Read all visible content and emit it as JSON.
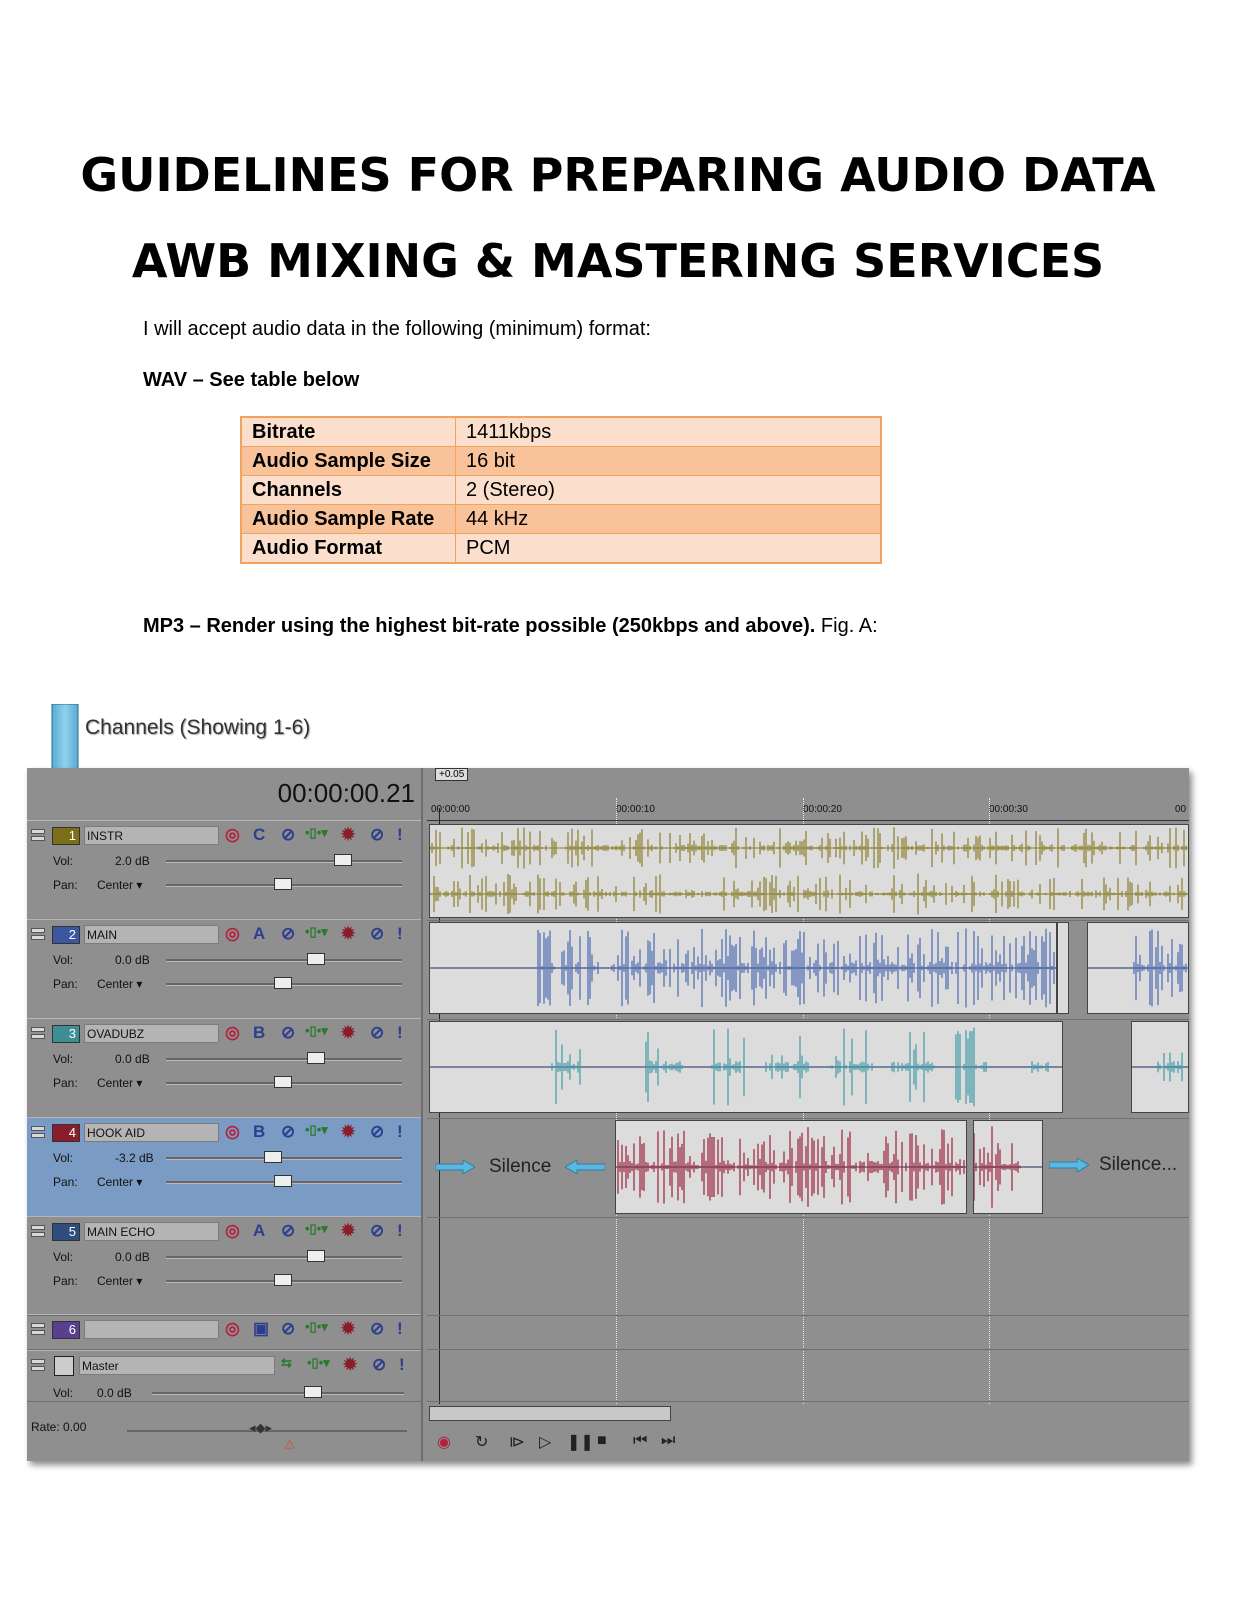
{
  "doc": {
    "title": "GUIDELINES FOR PREPARING AUDIO DATA",
    "subtitle": "AWB MIXING & MASTERING SERVICES",
    "intro": "I will accept audio data in the following (minimum) format:",
    "wav_heading": "WAV – See table below",
    "spec_table": [
      {
        "key": "Bitrate",
        "value": "1411kbps"
      },
      {
        "key": "Audio Sample Size",
        "value": "16 bit"
      },
      {
        "key": "Channels",
        "value": "2 (Stereo)"
      },
      {
        "key": "Audio Sample Rate",
        "value": "44 kHz"
      },
      {
        "key": "Audio Format",
        "value": "PCM"
      }
    ],
    "mp3_bold": "MP3 – Render using the highest bit-rate possible (250kbps and above).",
    "mp3_fig": " Fig. A:"
  },
  "figure": {
    "channels_label": "Channels (Showing 1-6)",
    "time_display": "00:00:00.21",
    "zoom_badge": "+0.05",
    "ruler": [
      "00:00:00",
      "00:00:10",
      "00:00:20",
      "00:00:30",
      "00"
    ],
    "tracks": [
      {
        "num": "1",
        "name": "INSTR",
        "letter": "C",
        "vol": "2.0 dB",
        "pan": "Center",
        "color": "#7c6f1a"
      },
      {
        "num": "2",
        "name": "MAIN",
        "letter": "A",
        "vol": "0.0 dB",
        "pan": "Center",
        "color": "#3a57a0"
      },
      {
        "num": "3",
        "name": "OVADUBZ",
        "letter": "B",
        "vol": "0.0 dB",
        "pan": "Center",
        "color": "#3d8f94"
      },
      {
        "num": "4",
        "name": "HOOK AID",
        "letter": "B",
        "vol": "-3.2 dB",
        "pan": "Center",
        "color": "#8a1d2c"
      },
      {
        "num": "5",
        "name": "MAIN ECHO",
        "letter": "A",
        "vol": "0.0 dB",
        "pan": "Center",
        "color": "#2e4d7a"
      }
    ],
    "track6": {
      "num": "6",
      "color": "#5b3f8f"
    },
    "master": {
      "name": "Master",
      "vol_label": "Vol:",
      "vol": "0.0 dB"
    },
    "vol_label": "Vol:",
    "pan_label": "Pan:",
    "rate": "Rate: 0.00",
    "silence_left": "Silence",
    "silence_right": "Silence...",
    "wave_colors": {
      "instr": "#8a7d2a",
      "main": "#4a69b0",
      "ovadubz": "#3f9aa6",
      "hook": "#9b2238"
    }
  }
}
